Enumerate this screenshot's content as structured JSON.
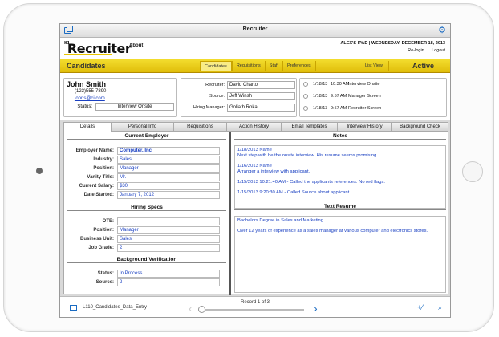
{
  "window": {
    "title": "Recruiter"
  },
  "header": {
    "logo_prefix": "ICI",
    "logo_text": "Recruiter",
    "about_label": "About",
    "device_info": "ALEX'S IPAD | WEDNESDAY, DECEMBER 18, 2013",
    "relogin_label": "Re-login",
    "logout_label": "Logout"
  },
  "nav": {
    "title": "Candidates",
    "status": "Active",
    "tabs": [
      {
        "label": "Candidates",
        "active": true
      },
      {
        "label": "Requisitions",
        "active": false
      },
      {
        "label": "Staff",
        "active": false
      },
      {
        "label": "Preferences",
        "active": false
      }
    ],
    "list_view_label": "List View"
  },
  "candidate": {
    "name": "John Smith",
    "phone": "(123)555-7890",
    "email": "johns@ci.com",
    "status_label": "Status:",
    "status_value": "Interview Onsite"
  },
  "recruiting": {
    "recruiter_label": "Recruiter:",
    "recruiter_value": "David Charto",
    "source_label": "Source:",
    "source_value": "Jeff Winsh",
    "hiring_manager_label": "Hiring Manager:",
    "hiring_manager_value": "Goliath Roka"
  },
  "activities": [
    {
      "date": "1/18/13",
      "time": "10:30 AM",
      "label": "Interview Onsite"
    },
    {
      "date": "1/18/13",
      "time": "9:57 AM",
      "label": "Manager Screen"
    },
    {
      "date": "1/18/13",
      "time": "9:57 AM",
      "label": "Recruiter Screen"
    }
  ],
  "tabs": [
    {
      "label": "Details",
      "active": true
    },
    {
      "label": "Personal Info",
      "active": false
    },
    {
      "label": "Requisitions",
      "active": false
    },
    {
      "label": "Action History",
      "active": false
    },
    {
      "label": "Email Templates",
      "active": false
    },
    {
      "label": "Interview History",
      "active": false
    },
    {
      "label": "Background Check",
      "active": false
    }
  ],
  "current_employer": {
    "heading": "Current Employer",
    "fields": [
      {
        "label": "Employer Name:",
        "value": "Computer, Inc"
      },
      {
        "label": "Industry:",
        "value": "Sales"
      },
      {
        "label": "Position:",
        "value": "Manager"
      },
      {
        "label": "Vanity Title:",
        "value": "Mr."
      },
      {
        "label": "Current Salary:",
        "value": "$30"
      },
      {
        "label": "Date Started:",
        "value": "January 7, 2012"
      }
    ]
  },
  "hiring_specs": {
    "heading": "Hiring Specs",
    "fields": [
      {
        "label": "OTE:",
        "value": ""
      },
      {
        "label": "Position:",
        "value": "Manager"
      },
      {
        "label": "Business Unit:",
        "value": "Sales"
      },
      {
        "label": "Job Grade:",
        "value": "2"
      }
    ]
  },
  "background_verification": {
    "heading": "Background Verification",
    "fields": [
      {
        "label": "Status:",
        "value": "In Process"
      },
      {
        "label": "Source:",
        "value": "2"
      }
    ]
  },
  "notes": {
    "heading": "Notes",
    "entries": [
      {
        "header": "1/18/2013  Name",
        "text": "Next step with be the onsite interview.  His resume seems promising."
      },
      {
        "header": "1/16/2013  Name",
        "text": "Arranger a interview with applicant."
      },
      {
        "header": "1/15/2013  10:21:40 AM -  Called the applicants references.  No red flags.",
        "text": ""
      },
      {
        "header": "1/15/2013  9:20:30 AM -  Called Source about applicant.",
        "text": ""
      }
    ]
  },
  "resume": {
    "heading": "Text Resume",
    "paragraphs": [
      "Bachelors Degree in Sales and Marketing.",
      "Over 12 years of experience as a sales manager at various computer and electronics stores."
    ]
  },
  "footer": {
    "layout_name": "L110_Candidates_Data_Entry",
    "record_text": "Record 1 of 3"
  }
}
